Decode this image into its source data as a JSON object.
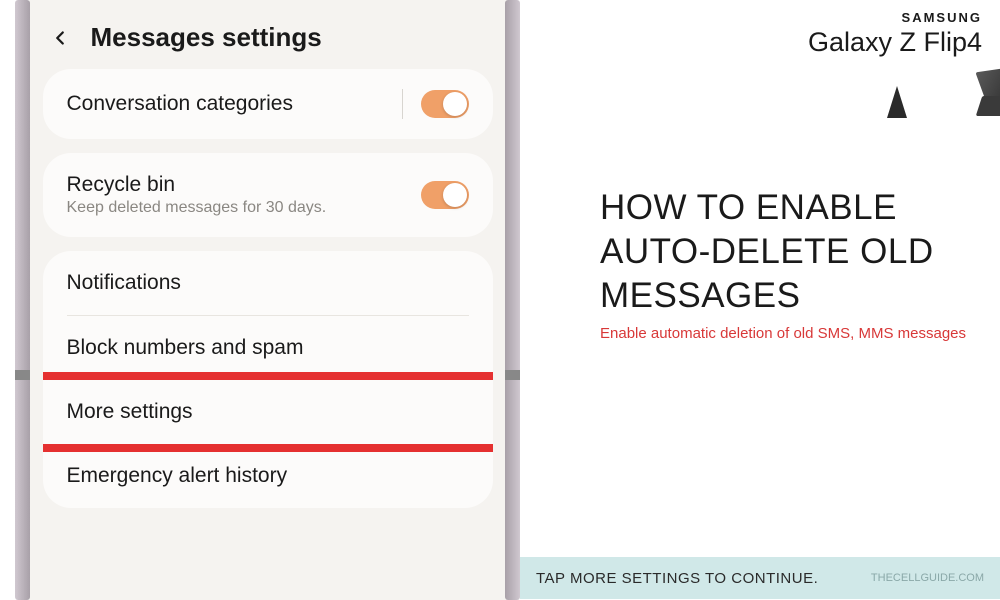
{
  "header": {
    "title": "Messages settings"
  },
  "settings": {
    "conversation_categories": {
      "label": "Conversation categories",
      "enabled": true
    },
    "recycle_bin": {
      "label": "Recycle bin",
      "sublabel": "Keep deleted messages for 30 days.",
      "enabled": true
    },
    "notifications": {
      "label": "Notifications"
    },
    "block_numbers": {
      "label": "Block numbers and spam"
    },
    "more_settings": {
      "label": "More settings"
    },
    "emergency_alert": {
      "label": "Emergency alert history"
    }
  },
  "brand": {
    "samsung": "SAMSUNG",
    "model": "Galaxy Z Flip4"
  },
  "article": {
    "title": "HOW TO ENABLE AUTO-DELETE OLD MESSAGES",
    "subtitle": "Enable automatic deletion of old SMS, MMS messages"
  },
  "footer": {
    "instruction": "TAP MORE SETTINGS TO CONTINUE.",
    "watermark": "THECELLGUIDE.COM"
  }
}
